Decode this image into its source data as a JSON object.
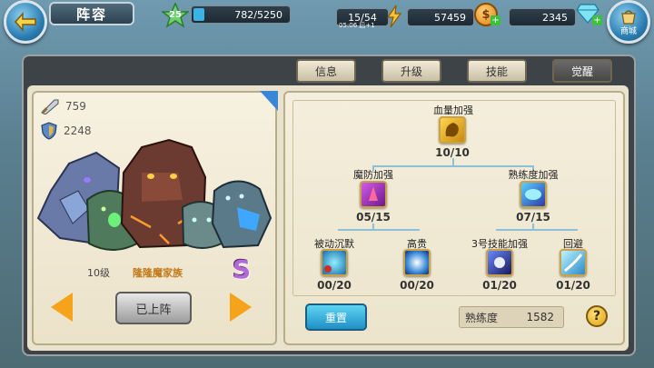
{
  "header": {
    "title": "阵容",
    "level": "25",
    "xp": "782/5250",
    "xp_fraction": 0.149,
    "stamina": "15/54",
    "stamina_timer": "05:06 后+1",
    "gold": "57459",
    "diamonds": "2345",
    "shop_label": "商城"
  },
  "tabs": [
    {
      "label": "信息"
    },
    {
      "label": "升级"
    },
    {
      "label": "技能"
    },
    {
      "label": "觉醒"
    }
  ],
  "unit": {
    "attack": "759",
    "defense": "2248",
    "level": "10级",
    "name": "隆隆魔家族",
    "grade": "S",
    "deploy_button": "已上阵"
  },
  "skill_tree": {
    "root": {
      "label": "血量加强",
      "count": "10/10"
    },
    "left": {
      "label": "魔防加强",
      "count": "05/15"
    },
    "right": {
      "label": "熟练度加强",
      "count": "07/15"
    },
    "leaves": [
      {
        "label": "被动沉默",
        "count": "00/20"
      },
      {
        "label": "高贵",
        "count": "00/20"
      },
      {
        "label": "3号技能加强",
        "count": "01/20"
      },
      {
        "label": "回避",
        "count": "01/20"
      }
    ]
  },
  "footer": {
    "reset_label": "重置",
    "proficiency_label": "熟练度",
    "proficiency_value": "1582",
    "help_label": "?"
  },
  "colors": {
    "accent_blue": "#3ab3e6",
    "gold": "#e0a010",
    "grade_purple": "#b46ad6"
  }
}
